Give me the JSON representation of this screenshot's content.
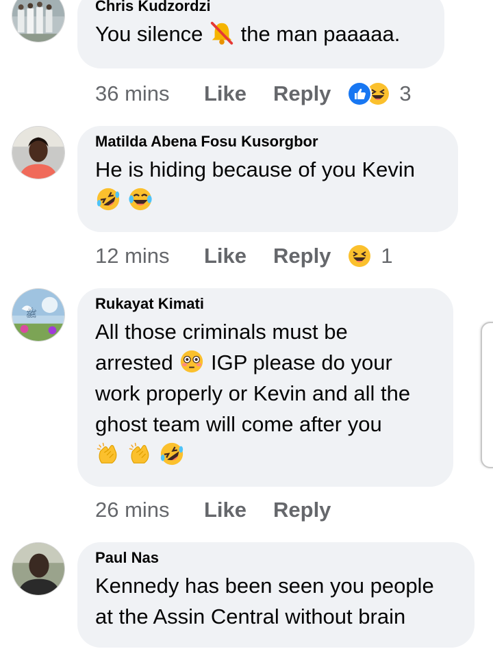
{
  "comments": [
    {
      "author": "Chris Kudzordzi",
      "text_before": "You silence",
      "emoji_inline": "muted-bell-emoji",
      "text_after": "the man paaaaa.",
      "time": "36 mins",
      "like_label": "Like",
      "reply_label": "Reply",
      "reactions": [
        "like-reaction-icon",
        "laughing-reaction-icon"
      ],
      "reaction_count": "3"
    },
    {
      "author": "Matilda Abena Fosu Kusorgbor",
      "text": "He is hiding because of you Kevin",
      "emojis": [
        "rolling-on-floor-laughing-emoji",
        "tears-of-joy-emoji"
      ],
      "time": "12 mins",
      "like_label": "Like",
      "reply_label": "Reply",
      "reactions": [
        "laughing-reaction-icon"
      ],
      "reaction_count": "1"
    },
    {
      "author": "Rukayat Kimati",
      "line1": "All those criminals must be",
      "line2_before": "arrested",
      "line2_emoji": "flushed-face-emoji",
      "line2_after": "IGP please do your",
      "line3": "work properly or Kevin and all the",
      "line4": "ghost team will come after you",
      "emojis": [
        "clapping-hands-emoji",
        "clapping-hands-emoji",
        "rolling-on-floor-laughing-emoji"
      ],
      "time": "26 mins",
      "like_label": "Like",
      "reply_label": "Reply"
    },
    {
      "author": "Paul Nas",
      "line1": "Kennedy has been seen you people",
      "line2": "at the Assin Central without brain"
    }
  ],
  "colors": {
    "bubble": "#f0f2f5",
    "text": "#050505",
    "meta": "#65676b",
    "like_blue": "#1877f2",
    "emoji_yellow": "#fbc02d"
  }
}
